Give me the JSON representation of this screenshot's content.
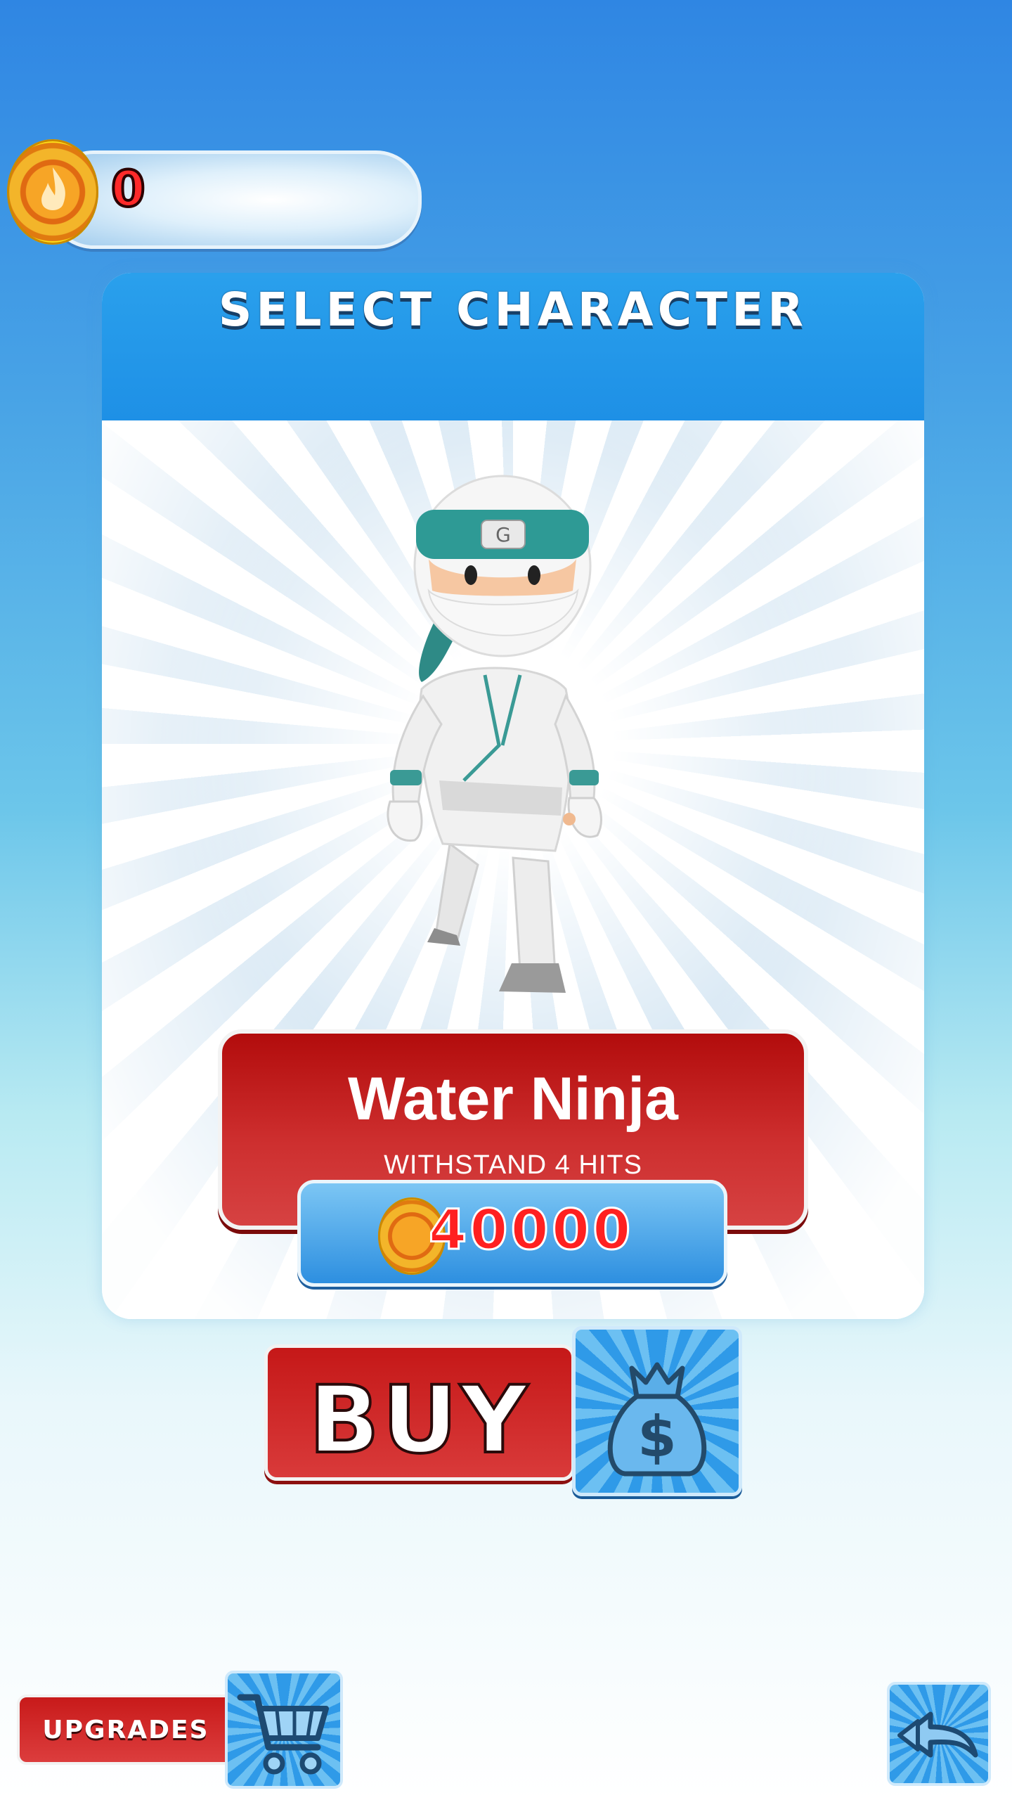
{
  "coins": {
    "count": "0",
    "icon": "fire-coin-icon"
  },
  "panel": {
    "title": "SELECT CHARACTER"
  },
  "character": {
    "name": "Water Ninja",
    "description": "WITHSTAND 4 HITS",
    "price": "40000",
    "price_icon": "fire-coin-icon"
  },
  "actions": {
    "buy_label": "BUY",
    "buy_icon": "money-bag-icon",
    "upgrades_label": "UPGRADES",
    "cart_icon": "shopping-cart-icon",
    "back_icon": "back-arrow-icon"
  },
  "colors": {
    "accent_red": "#c51818",
    "accent_blue": "#1e90e6",
    "coin_gold": "#ffe11a"
  }
}
